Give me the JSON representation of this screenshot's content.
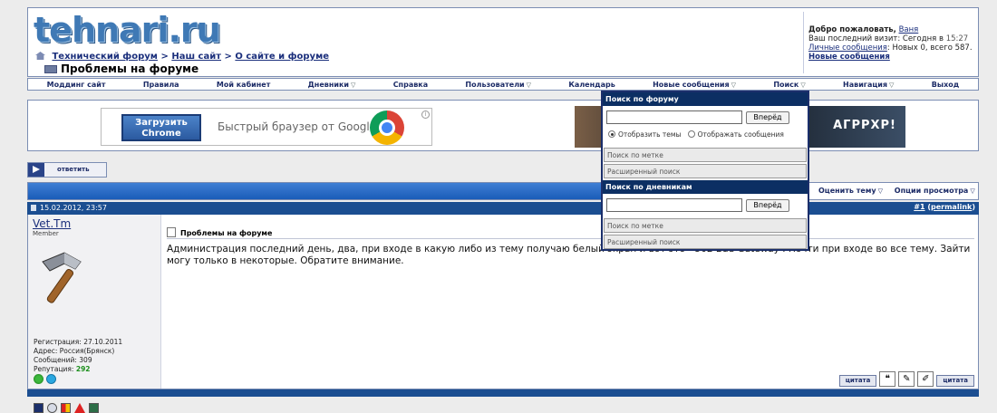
{
  "header": {
    "logo": "tehnari.ru",
    "breadcrumbs": [
      "Технический форум",
      "Наш сайт",
      "О сайте и форуме"
    ],
    "crumb_sep": ">",
    "page_title": "Проблемы на форуме"
  },
  "welcome": {
    "greeting": "Добро пожаловать,",
    "username": "Ваня",
    "last_visit_label": "Ваш последний визит: Сегодня в",
    "last_visit_time": "15:27",
    "pm_label": "Личные сообщения",
    "pm_counts": ": Новых 0, всего 587.",
    "new_posts": "Новые сообщения"
  },
  "nav": {
    "items": [
      {
        "label": "Моддинг сайт",
        "menu": false
      },
      {
        "label": "Правила",
        "menu": false
      },
      {
        "label": "Мой кабинет",
        "menu": false
      },
      {
        "label": "Дневники",
        "menu": true
      },
      {
        "label": "Справка",
        "menu": false
      },
      {
        "label": "Пользователи",
        "menu": true
      },
      {
        "label": "Календарь",
        "menu": false
      },
      {
        "label": "Новые сообщения",
        "menu": true
      },
      {
        "label": "Поиск",
        "menu": true
      },
      {
        "label": "Навигация",
        "menu": true
      },
      {
        "label": "Выход",
        "menu": false
      }
    ]
  },
  "ads": {
    "chrome_button": "Загрузить Chrome",
    "chrome_text": "Быстрый браузер от Google",
    "info": "i",
    "game_text": "АГРРХР!"
  },
  "reply_button": "ответить",
  "thread_tools": {
    "rate": "Оценить тему",
    "view_options": "Опции просмотра"
  },
  "post": {
    "date": "15.02.2012, 23:57",
    "number": "#1",
    "permalink": "permalink",
    "author": "Vet.Tm",
    "author_title": "Member",
    "registration": "Регистрация: 27.10.2011",
    "address": "Адрес: Россия(Брянск)",
    "posts": "Сообщений: 309",
    "reputation_label": "Репутация:",
    "reputation": "292",
    "title": "Проблемы на форуме",
    "text": "Администрация последний день, два, при входе в какую либо из тему получаю белый экран и вот это - 502 Bad Gateway . Почти при входе во все тему. Зайти могу только в некоторые. Обратите внимание.",
    "quote_button": "цитата",
    "quote_button2": "цитата"
  },
  "search_popup": {
    "forum_header": "Поиск по форуму",
    "go": "Вперёд",
    "show_threads": "Отобразить темы",
    "show_posts": "Отображать сообщения",
    "tag_search": "Поиск по метке",
    "advanced": "Расширенный поиск",
    "diary_header": "Поиск по дневникам",
    "go2": "Вперёд",
    "tag_search2": "Поиск по метке",
    "advanced2": "Расширенный поиск"
  },
  "colors": {
    "accent_blue": "#1b4e91",
    "link": "#1b2f7c",
    "reputation_green": "#1b8e1b"
  }
}
